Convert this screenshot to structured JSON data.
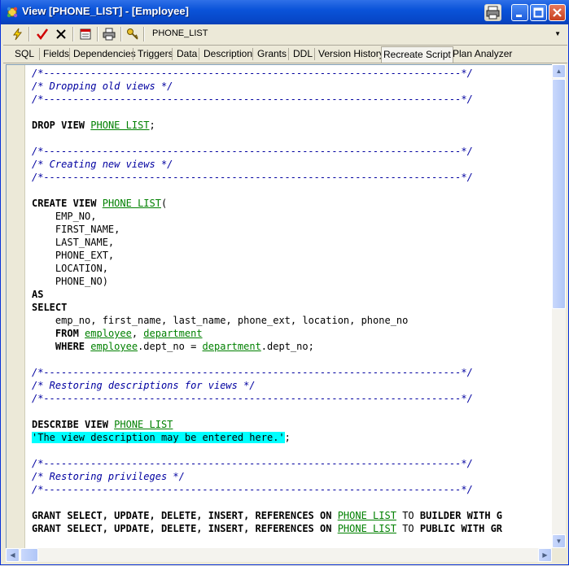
{
  "window": {
    "title": "View [PHONE_LIST] - [Employee]"
  },
  "toolbar": {
    "object_name": "PHONE_LIST",
    "icons": [
      "compile-icon",
      "commit-icon",
      "rollback-icon",
      "calendar-icon",
      "print-icon",
      "keys-icon"
    ]
  },
  "tabs": [
    {
      "label": "SQL"
    },
    {
      "label": "Fields"
    },
    {
      "label": "Dependencies"
    },
    {
      "label": "Triggers"
    },
    {
      "label": "Data"
    },
    {
      "label": "Description"
    },
    {
      "label": "Grants"
    },
    {
      "label": "DDL"
    },
    {
      "label": "Version History"
    },
    {
      "label": "Recreate Script"
    },
    {
      "label": "Plan Analyzer"
    }
  ],
  "active_tab": "Recreate Script",
  "code": {
    "rule": "/*-----------------------------------------------------------------------*/",
    "drop_comment": "/* Dropping old views */",
    "create_comment": "/* Creating new views */",
    "describe_comment": "/* Restoring descriptions for views */",
    "grants_comment": "/* Restoring privileges */",
    "kw_drop_view": "DROP VIEW",
    "kw_create_view": "CREATE VIEW",
    "kw_as": "AS",
    "kw_select": "SELECT",
    "kw_from": "FROM",
    "kw_where": "WHERE",
    "kw_describe_view": "DESCRIBE VIEW",
    "view_name": "PHONE LIST",
    "fields": [
      "EMP_NO,",
      "FIRST_NAME,",
      "LAST_NAME,",
      "PHONE_EXT,",
      "LOCATION,",
      "PHONE_NO)"
    ],
    "select_list": "emp_no, first_name, last_name, phone_ext, location, phone_no",
    "table_employee": "employee",
    "table_department": "department",
    "where_col": ".dept_no",
    "description": "'The view description may be entered here.'",
    "grant_prefix": "GRANT SELECT, UPDATE, DELETE, INSERT, REFERENCES",
    "kw_on": "ON",
    "kw_to": "TO",
    "grant_builder_suffix": "BUILDER WITH G",
    "grant_public_suffix": "PUBLIC WITH GR"
  },
  "colors": {
    "comment": "#0000A0",
    "identifier": "#008000",
    "string_highlight": "#00FFFF"
  }
}
